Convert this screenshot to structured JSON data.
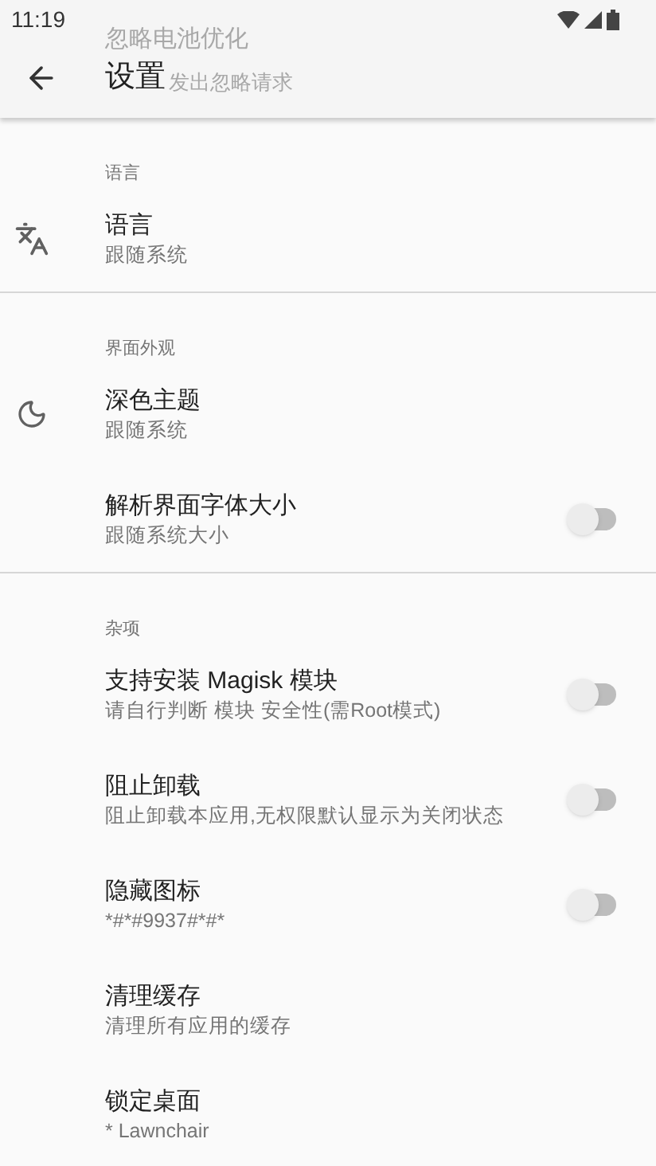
{
  "status_bar": {
    "time": "11:19"
  },
  "app_bar": {
    "title": "设置",
    "ghost_title": "忽略电池优化",
    "ghost_subtitle": "发出忽略请求"
  },
  "sections": [
    {
      "header": "语言",
      "items": [
        {
          "kind": "language",
          "title": "语言",
          "subtitle": "跟随系统"
        }
      ]
    },
    {
      "header": "界面外观",
      "items": [
        {
          "kind": "theme",
          "title": "深色主题",
          "subtitle": "跟随系统"
        },
        {
          "kind": "switch",
          "title": "解析界面字体大小",
          "subtitle": "跟随系统大小",
          "on": false
        }
      ]
    },
    {
      "header": "杂项",
      "items": [
        {
          "kind": "switch",
          "title": "支持安装 Magisk 模块",
          "subtitle": "请自行判断 模块 安全性(需Root模式)",
          "on": false
        },
        {
          "kind": "switch",
          "title": "阻止卸载",
          "subtitle": "阻止卸载本应用,无权限默认显示为关闭状态",
          "on": false
        },
        {
          "kind": "switch",
          "title": "隐藏图标",
          "subtitle": "*#*#9937#*#*",
          "on": false
        },
        {
          "kind": "plain",
          "title": "清理缓存",
          "subtitle": "清理所有应用的缓存"
        },
        {
          "kind": "plain",
          "title": "锁定桌面",
          "subtitle": "* Lawnchair"
        }
      ]
    }
  ]
}
